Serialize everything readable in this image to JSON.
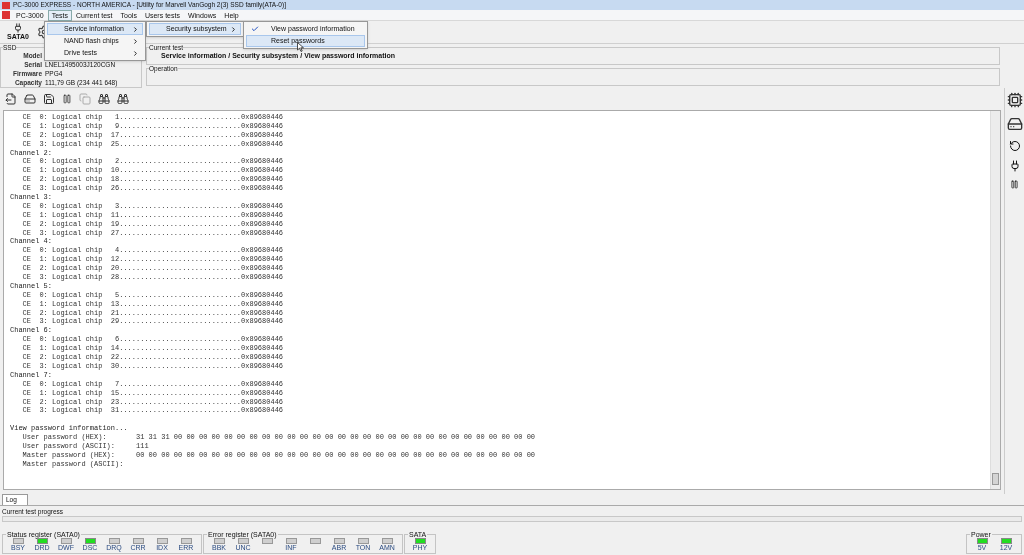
{
  "window": {
    "title": "PC-3000 EXPRESS - NORTH AMERICA - [Utility for Marvell VanGogh 2(3) SSD family(ATA-0)]"
  },
  "menu_bar": [
    {
      "label": "PC-3000",
      "selected": false
    },
    {
      "label": "Tests",
      "selected": true
    },
    {
      "label": "Current test",
      "selected": false
    },
    {
      "label": "Tools",
      "selected": false
    },
    {
      "label": "Users tests",
      "selected": false
    },
    {
      "label": "Windows",
      "selected": false
    },
    {
      "label": "Help",
      "selected": false
    }
  ],
  "tests_menu": [
    {
      "label": "Service information",
      "selected": true
    },
    {
      "label": "NAND flash chips",
      "selected": false
    },
    {
      "label": "Drive tests",
      "selected": false
    }
  ],
  "service_submenu": [
    {
      "label": "Security subsystem",
      "selected": true
    }
  ],
  "security_submenu": [
    {
      "label": "View password information",
      "checked": true,
      "selected": false
    },
    {
      "label": "Reset passwords",
      "checked": false,
      "selected": true
    }
  ],
  "toolbar": {
    "sata_button": "SATA0"
  },
  "ssd_panel": {
    "title": "SSD",
    "fields": [
      {
        "label": "Model"
      },
      {
        "label": "Serial",
        "value": "LNEL1495003J120CGN"
      },
      {
        "label": "Firmware",
        "value": "PPG4"
      },
      {
        "label": "Capacity",
        "value": "111,79 GB (234 441 648)"
      }
    ]
  },
  "current_test": {
    "title": "Current test",
    "value": "Service information / Security subsystem / View password information"
  },
  "operation": {
    "title": "Operation"
  },
  "log": {
    "lines": [
      {
        "kind": "chip",
        "text": "   CE  0: Logical chip   1.............................0x89680446"
      },
      {
        "kind": "chip",
        "text": "   CE  1: Logical chip   9.............................0x89680446"
      },
      {
        "kind": "chip",
        "text": "   CE  2: Logical chip  17.............................0x89680446"
      },
      {
        "kind": "chip",
        "text": "   CE  3: Logical chip  25.............................0x89680446"
      },
      {
        "kind": "channel",
        "text": "Channel 2:"
      },
      {
        "kind": "chip",
        "text": "   CE  0: Logical chip   2.............................0x89680446"
      },
      {
        "kind": "chip",
        "text": "   CE  1: Logical chip  10.............................0x89680446"
      },
      {
        "kind": "chip",
        "text": "   CE  2: Logical chip  18.............................0x89680446"
      },
      {
        "kind": "chip",
        "text": "   CE  3: Logical chip  26.............................0x89680446"
      },
      {
        "kind": "channel",
        "text": "Channel 3:"
      },
      {
        "kind": "chip",
        "text": "   CE  0: Logical chip   3.............................0x89680446"
      },
      {
        "kind": "chip",
        "text": "   CE  1: Logical chip  11.............................0x89680446"
      },
      {
        "kind": "chip",
        "text": "   CE  2: Logical chip  19.............................0x89680446"
      },
      {
        "kind": "chip",
        "text": "   CE  3: Logical chip  27.............................0x89680446"
      },
      {
        "kind": "channel",
        "text": "Channel 4:"
      },
      {
        "kind": "chip",
        "text": "   CE  0: Logical chip   4.............................0x89680446"
      },
      {
        "kind": "chip",
        "text": "   CE  1: Logical chip  12.............................0x89680446"
      },
      {
        "kind": "chip",
        "text": "   CE  2: Logical chip  20.............................0x89680446"
      },
      {
        "kind": "chip",
        "text": "   CE  3: Logical chip  28.............................0x89680446"
      },
      {
        "kind": "channel",
        "text": "Channel 5:"
      },
      {
        "kind": "chip",
        "text": "   CE  0: Logical chip   5.............................0x89680446"
      },
      {
        "kind": "chip",
        "text": "   CE  1: Logical chip  13.............................0x89680446"
      },
      {
        "kind": "chip",
        "text": "   CE  2: Logical chip  21.............................0x89680446"
      },
      {
        "kind": "chip",
        "text": "   CE  3: Logical chip  29.............................0x89680446"
      },
      {
        "kind": "channel",
        "text": "Channel 6:"
      },
      {
        "kind": "chip",
        "text": "   CE  0: Logical chip   6.............................0x89680446"
      },
      {
        "kind": "chip",
        "text": "   CE  1: Logical chip  14.............................0x89680446"
      },
      {
        "kind": "chip",
        "text": "   CE  2: Logical chip  22.............................0x89680446"
      },
      {
        "kind": "chip",
        "text": "   CE  3: Logical chip  30.............................0x89680446"
      },
      {
        "kind": "channel",
        "text": "Channel 7:"
      },
      {
        "kind": "chip",
        "text": "   CE  0: Logical chip   7.............................0x89680446"
      },
      {
        "kind": "chip",
        "text": "   CE  1: Logical chip  15.............................0x89680446"
      },
      {
        "kind": "chip",
        "text": "   CE  2: Logical chip  23.............................0x89680446"
      },
      {
        "kind": "chip",
        "text": "   CE  3: Logical chip  31.............................0x89680446"
      },
      {
        "kind": "section",
        "text": "View password information..."
      },
      {
        "kind": "field",
        "label": "User password (HEX):",
        "value": "31 31 31 00 00 00 00 00 00 00 00 00 00 00 00 00 00 00 00 00 00 00 00 00 00 00 00 00 00 00 00 00"
      },
      {
        "kind": "field",
        "label": "User password (ASCII):",
        "value": "111"
      },
      {
        "kind": "field",
        "label": "Master password (HEX):",
        "value": "00 00 00 00 00 00 00 00 00 00 00 00 00 00 00 00 00 00 00 00 00 00 00 00 00 00 00 00 00 00 00 00"
      },
      {
        "kind": "field",
        "label": "Master password (ASCII):"
      }
    ]
  },
  "tabs": [
    {
      "label": "Log",
      "selected": true
    }
  ],
  "progress": {
    "label": "Current test progress",
    "level": 0
  },
  "status_register": {
    "title": "Status register (SATA0)",
    "leds": [
      {
        "label": "BSY",
        "on": false
      },
      {
        "label": "DRD",
        "on": true
      },
      {
        "label": "DWF",
        "on": false
      },
      {
        "label": "DSC",
        "on": true
      },
      {
        "label": "DRQ",
        "on": false
      },
      {
        "label": "CRR",
        "on": false
      },
      {
        "label": "IDX",
        "on": false
      },
      {
        "label": "ERR",
        "on": false
      }
    ]
  },
  "error_register": {
    "title": "Error register (SATA0)",
    "leds": [
      {
        "label": "BBK",
        "on": false
      },
      {
        "label": "UNC",
        "on": false
      },
      {
        "on": false
      },
      {
        "label": "INF",
        "on": false
      },
      {
        "on": false
      },
      {
        "label": "ABR",
        "on": false
      },
      {
        "label": "TON",
        "on": false
      },
      {
        "label": "AMN",
        "on": false
      }
    ]
  },
  "sata": {
    "title": "SATA",
    "leds": [
      {
        "label": "PHY",
        "on": true
      }
    ]
  },
  "power": {
    "title": "Power",
    "leds": [
      {
        "label": "5V",
        "on": true
      },
      {
        "label": "12V",
        "on": true
      }
    ]
  }
}
